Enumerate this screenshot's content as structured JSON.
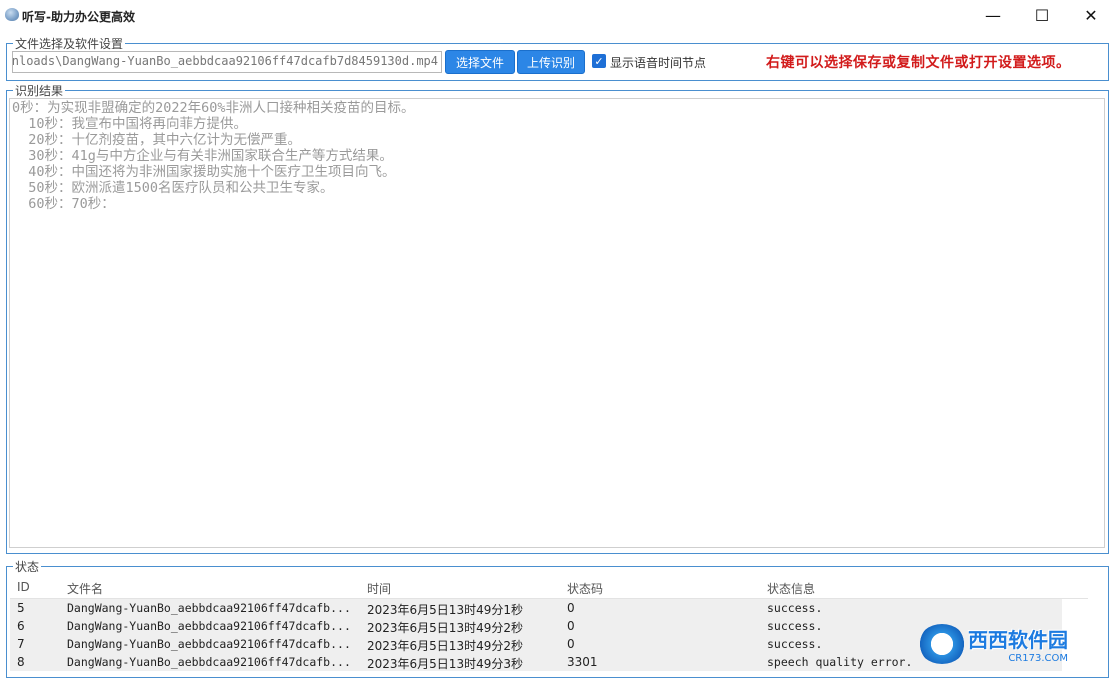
{
  "window": {
    "title": "听写-助力办公更高效",
    "minimize_glyph": "—",
    "maximize_glyph": "☐",
    "close_glyph": "✕"
  },
  "settings": {
    "legend": "文件选择及软件设置",
    "file_path": "ownloads\\DangWang-YuanBo_aebbdcaa92106ff47dcafb7d8459130d.mp4",
    "select_file_label": "选择文件",
    "upload_label": "上传识别",
    "show_timestamps_label": "显示语音时间节点",
    "show_timestamps_checked": true,
    "hint": "右键可以选择保存或复制文件或打开设置选项。"
  },
  "result": {
    "legend": "识别结果",
    "lines": [
      "0秒：为实现非盟确定的2022年60%非洲人口接种相关疫苗的目标。",
      "  10秒：我宣布中国将再向菲方提供。",
      "  20秒：十亿剂疫苗，其中六亿计为无偿严重。",
      "  30秒：41g与中方企业与有关非洲国家联合生产等方式结果。",
      "  40秒：中国还将为非洲国家援助实施十个医疗卫生项目向飞。",
      "  50秒：欧洲派遣1500名医疗队员和公共卫生专家。",
      "  60秒：70秒："
    ]
  },
  "status": {
    "legend": "状态",
    "columns": [
      "ID",
      "文件名",
      "时间",
      "状态码",
      "状态信息"
    ],
    "rows": [
      {
        "id": "5",
        "file": "DangWang-YuanBo_aebbdcaa92106ff47dcafb...",
        "time": "2023年6月5日13时49分1秒",
        "code": "0",
        "info": "success."
      },
      {
        "id": "6",
        "file": "DangWang-YuanBo_aebbdcaa92106ff47dcafb...",
        "time": "2023年6月5日13时49分2秒",
        "code": "0",
        "info": "success."
      },
      {
        "id": "7",
        "file": "DangWang-YuanBo_aebbdcaa92106ff47dcafb...",
        "time": "2023年6月5日13时49分2秒",
        "code": "0",
        "info": "success."
      },
      {
        "id": "8",
        "file": "DangWang-YuanBo_aebbdcaa92106ff47dcafb...",
        "time": "2023年6月5日13时49分3秒",
        "code": "3301",
        "info": "speech quality error."
      }
    ]
  },
  "watermark": {
    "main": "西西软件园",
    "sub": "CR173.COM"
  }
}
